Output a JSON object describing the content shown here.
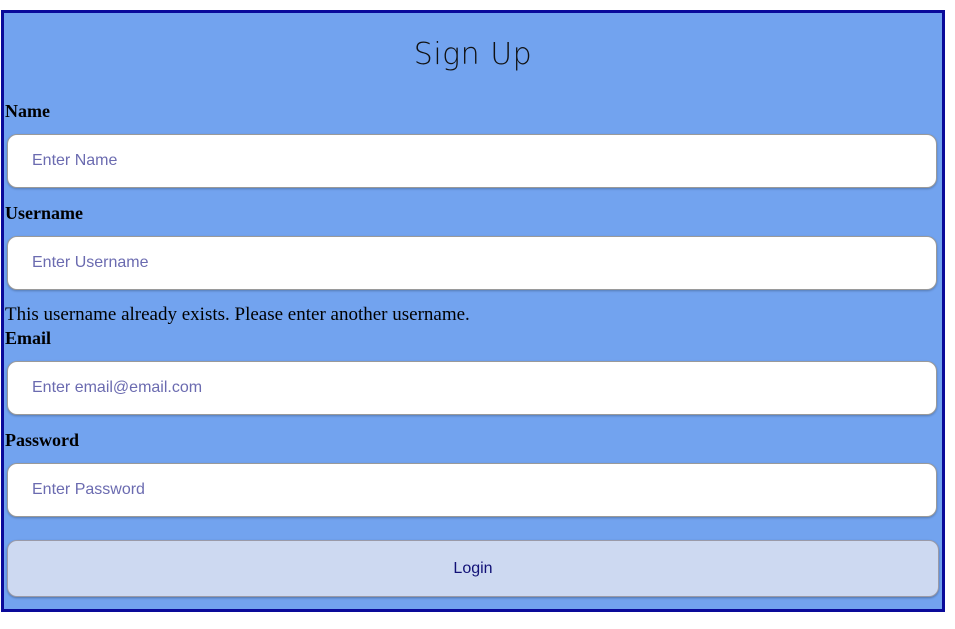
{
  "form": {
    "title": "Sign Up",
    "fields": [
      {
        "label": "Name",
        "placeholder": "Enter Name",
        "value": ""
      },
      {
        "label": "Username",
        "placeholder": "Enter Username",
        "value": ""
      },
      {
        "label": "Email",
        "placeholder": "Enter email@email.com",
        "value": ""
      },
      {
        "label": "Password",
        "placeholder": "Enter Password",
        "value": ""
      }
    ],
    "username_error": "This username already exists. Please enter another username.",
    "submit_label": "Login"
  },
  "colors": {
    "background": "#72a3ef",
    "border": "#0a0a9a",
    "button": "#cdd9f1"
  }
}
